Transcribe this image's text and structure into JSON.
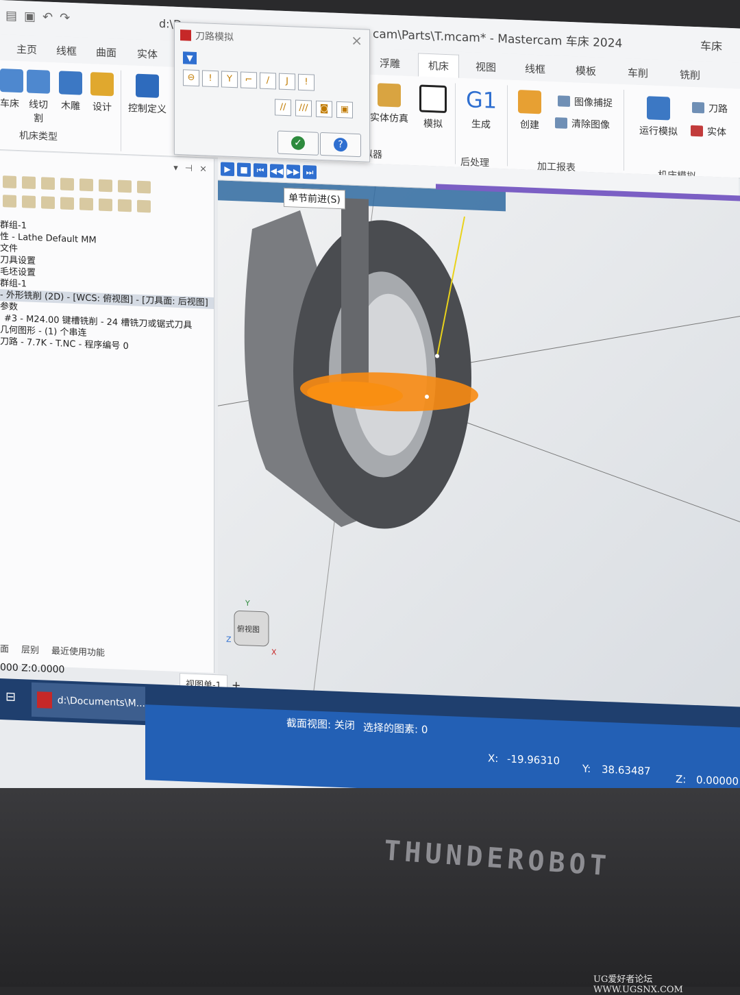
{
  "titlebar": {
    "path_left": "d:\\D",
    "title": "cam\\Parts\\T.mcam* - Mastercam 车床 2024",
    "context": "车床"
  },
  "tabs": [
    "主页",
    "线框",
    "曲面",
    "实体",
    "浮雕",
    "机床",
    "视图",
    "线框",
    "模板",
    "车削",
    "铣削"
  ],
  "active_tab_index": 5,
  "ribbon": {
    "left_buttons": [
      "车床",
      "线切割",
      "木雕",
      "设计",
      "控制定义"
    ],
    "left_group_label": "机床类型",
    "sim_buttons": [
      "实体仿真",
      "模拟"
    ],
    "sim_group_label": "拟器",
    "post_button_icon": "G1",
    "post_button": "生成",
    "post_group_label": "后处理",
    "report_button": "创建",
    "report_small": [
      "图像捕捉",
      "清除图像"
    ],
    "report_group_label": "加工报表",
    "machine_button": "运行模拟",
    "machine_small": [
      "刀路",
      "实体"
    ],
    "machine_group_label": "机床模拟"
  },
  "dialog": {
    "title": "刀路模拟",
    "close": "×",
    "ok_icon": "✓",
    "help_icon": "?"
  },
  "manager": {
    "header_icons": [
      "▾",
      "⊣",
      "×"
    ],
    "tree": [
      "群组-1",
      "性 - Lathe Default MM",
      "文件",
      "刀具设置",
      "毛坯设置",
      "群组-1",
      "- 外形铣削 (2D) - [WCS: 俯视图] - [刀具面: 后视图]",
      "参数",
      "#3 - M24.00 键槽铣削 - 24 槽铣刀或锯式刀具",
      "几何图形 - (1) 个串连",
      "刀路 - 7.7K - T.NC - 程序编号 0"
    ],
    "selected_index": 6,
    "bottom_tabs": [
      "面",
      "层别",
      "最近使用功能"
    ]
  },
  "playback": {
    "buttons": [
      "▶",
      "■",
      "⏮",
      "◀◀",
      "▶▶",
      "⏭"
    ],
    "tooltip": "单节前进(S)"
  },
  "viewcube": {
    "label": "俯视图",
    "axes": [
      "Y",
      "Z",
      "X"
    ]
  },
  "view_tabs": {
    "active": "视图单-1",
    "add": "+"
  },
  "coord_left": "000  Z:0.0000",
  "taskbar": {
    "item": "d:\\Documents\\M..."
  },
  "statusbar": {
    "section_view": "截面视图: 关闭",
    "selected": "选择的图素: 0",
    "x_label": "X:",
    "x_value": "-19.96310",
    "y_label": "Y:",
    "y_value": "38.63487",
    "z_label": "Z:",
    "z_value": "0.00000"
  },
  "bezel": {
    "brand": "THUNDEROBOT"
  },
  "watermark": "UG爱好者论坛 WWW.UGSNX.COM",
  "colors": {
    "accent": "#2f6fd0",
    "statusbar": "#2360b5",
    "cutter": "#f7a21b",
    "progress": "#7b5fc4"
  }
}
